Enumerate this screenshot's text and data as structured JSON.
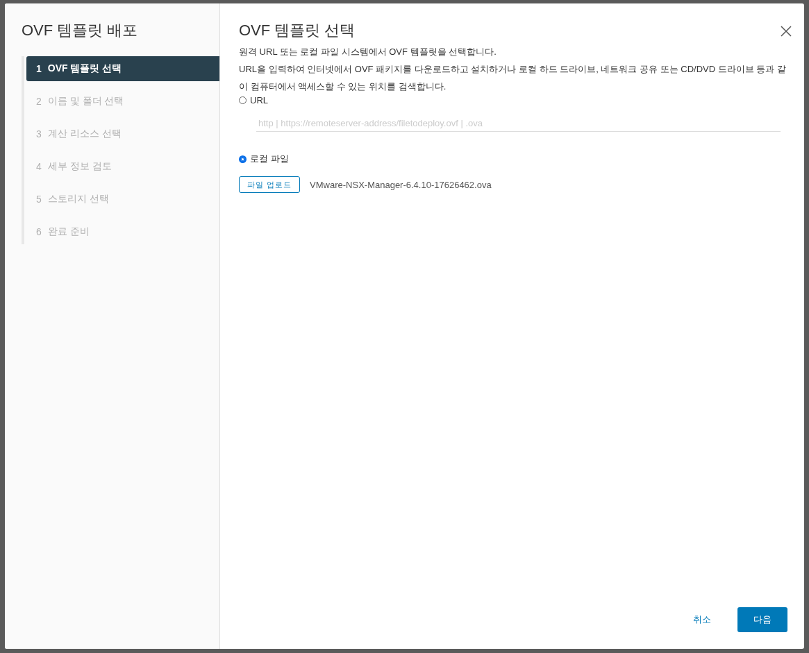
{
  "sidebar": {
    "title": "OVF 템플릿 배포",
    "steps": [
      {
        "number": "1",
        "label": "OVF 템플릿 선택",
        "selected": true
      },
      {
        "number": "2",
        "label": "이름 및 폴더 선택",
        "selected": false
      },
      {
        "number": "3",
        "label": "계산 리소스 선택",
        "selected": false
      },
      {
        "number": "4",
        "label": "세부 정보 검토",
        "selected": false
      },
      {
        "number": "5",
        "label": "스토리지 선택",
        "selected": false
      },
      {
        "number": "6",
        "label": "완료 준비",
        "selected": false
      }
    ]
  },
  "content": {
    "title": "OVF 템플릿 선택",
    "description": [
      "원격 URL 또는 로컬 파일 시스템에서 OVF 템플릿을 선택합니다.",
      "URL을 입력하여 인터넷에서 OVF 패키지를 다운로드하고 설치하거나 로컬 하드 드라이브, 네트워크 공유 또는 CD/DVD 드라이브 등과 같이 컴퓨터에서 액세스할 수 있는 위치를 검색합니다."
    ],
    "options": [
      {
        "kind": "url",
        "label": "URL",
        "selected": false,
        "placeholder": "http | https://remoteserver-address/filetodeploy.ovf | .ova"
      },
      {
        "kind": "file",
        "label": "로컬 파일",
        "selected": true,
        "button": "파일 업로드",
        "file_name": "VMware-NSX-Manager-6.4.10-17626462.ova"
      }
    ]
  },
  "footer": {
    "cancel": "취소",
    "next": "다음"
  }
}
